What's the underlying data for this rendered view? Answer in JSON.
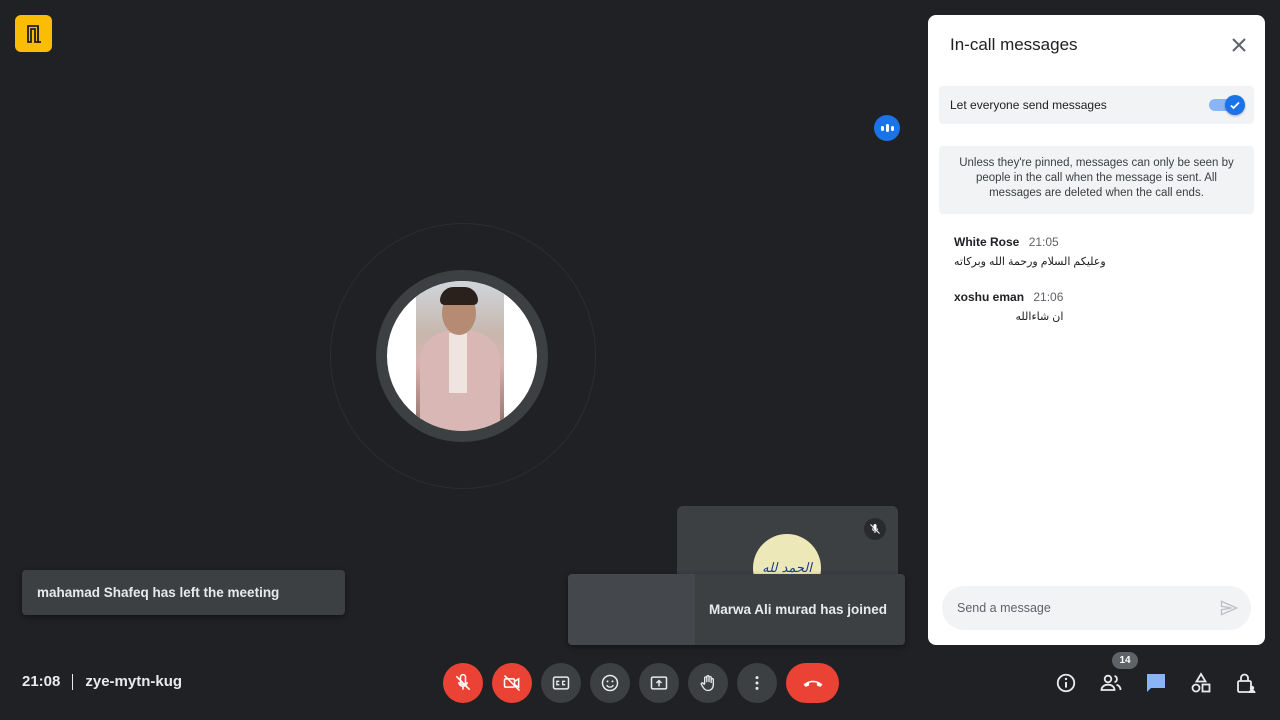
{
  "meeting": {
    "time": "21:08",
    "code": "zye-mytn-kug"
  },
  "toasts": {
    "left": "mahamad Shafeq has left the meeting",
    "joined": "Marwa Ali murad has joined"
  },
  "tile": {
    "avatar_text": "الحمد لله"
  },
  "panel": {
    "title": "In-call messages",
    "toggle_label": "Let everyone send messages",
    "toggle_on": true,
    "info": "Unless they're pinned, messages can only be seen by people in the call when the message is sent. All messages are deleted when the call ends.",
    "messages": [
      {
        "sender": "White Rose",
        "time": "21:05",
        "text": "وعليكم السلام ورحمة الله وبركاته"
      },
      {
        "sender": "xoshu eman",
        "time": "21:06",
        "text": "ان شاءالله"
      }
    ],
    "input_placeholder": "Send a message"
  },
  "people_count": "14",
  "colors": {
    "background": "#202124",
    "accent": "#1a73e8",
    "danger": "#ea4335",
    "brand": "#fbbc04"
  }
}
